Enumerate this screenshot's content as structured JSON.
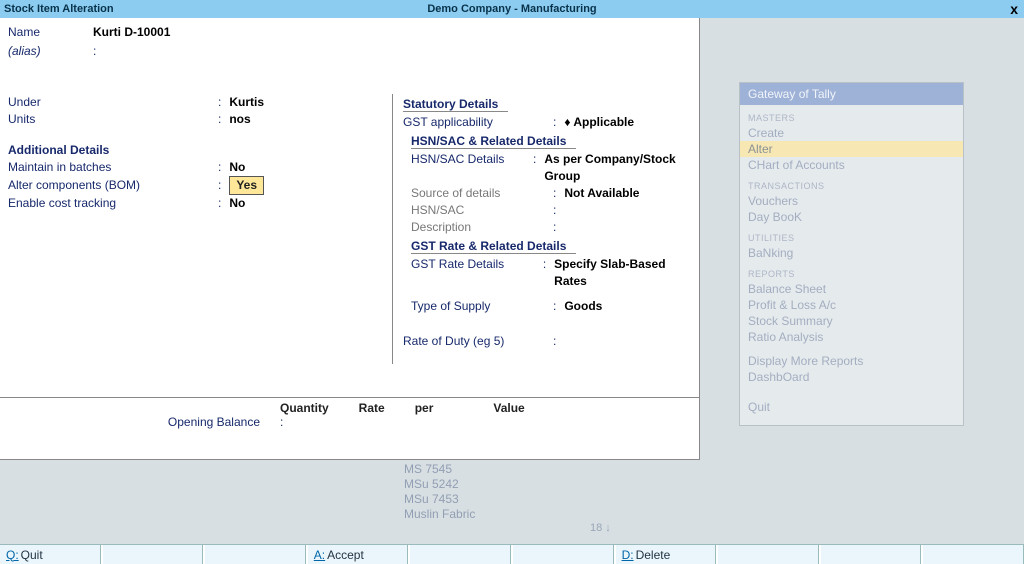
{
  "titlebar": {
    "left": "Stock Item Alteration",
    "center": "Demo Company - Manufacturing",
    "close": "x"
  },
  "name_row": {
    "label": "Name",
    "value": "Kurti D-10001"
  },
  "alias_row": {
    "label": "(alias)",
    "value": ""
  },
  "left": {
    "under": {
      "label": "Under",
      "value": "Kurtis"
    },
    "units": {
      "label": "Units",
      "value": "nos"
    },
    "additional_head": "Additional Details",
    "maintain": {
      "label": "Maintain in batches",
      "value": "No"
    },
    "alter_bom": {
      "label": "Alter components (BOM)",
      "value": "Yes"
    },
    "cost_track": {
      "label": "Enable cost tracking",
      "value": "No"
    }
  },
  "right": {
    "statutory_head": "Statutory Details",
    "gst_app": {
      "label": "GST applicability",
      "value": "♦ Applicable"
    },
    "hsn_head": "HSN/SAC & Related Details",
    "hsn_details": {
      "label": "HSN/SAC Details",
      "value": "As per Company/Stock Group"
    },
    "src_details": {
      "label": "Source of details",
      "value": "Not Available"
    },
    "hsn_sac": {
      "label": "HSN/SAC",
      "value": ""
    },
    "desc": {
      "label": "Description",
      "value": ""
    },
    "gst_rate_head": "GST Rate & Related Details",
    "gst_rate_details": {
      "label": "GST Rate Details",
      "value": "Specify Slab-Based Rates"
    },
    "type_supply": {
      "label": "Type of Supply",
      "value": "Goods"
    },
    "rate_duty": {
      "label": "Rate of Duty (eg 5)",
      "value": ""
    }
  },
  "opening": {
    "h_qty": "Quantity",
    "h_rate": "Rate",
    "h_per": "per",
    "h_value": "Value",
    "label": "Opening Balance"
  },
  "gateway": {
    "title": "Gateway of Tally",
    "masters_head": "MASTERS",
    "masters": [
      "Create",
      "Alter",
      "CHart of Accounts"
    ],
    "tx_head": "TRANSACTIONS",
    "tx": [
      "Vouchers",
      "Day BooK"
    ],
    "util_head": "UTILITIES",
    "util": [
      "BaNking"
    ],
    "rep_head": "REPORTS",
    "rep": [
      "Balance Sheet",
      "Profit & Loss A/c",
      "Stock Summary",
      "Ratio Analysis",
      "Display More Reports",
      "DashbOard"
    ],
    "quit": "Quit"
  },
  "behind": {
    "items": [
      "MS 7545",
      "MSu 5242",
      "MSu 7453",
      "Muslin Fabric"
    ],
    "count": "18 ↓"
  },
  "bottom": {
    "quit_key": "Q:",
    "quit": "Quit",
    "accept_key": "A:",
    "accept": "Accept",
    "delete_key": "D:",
    "delete": "Delete"
  }
}
